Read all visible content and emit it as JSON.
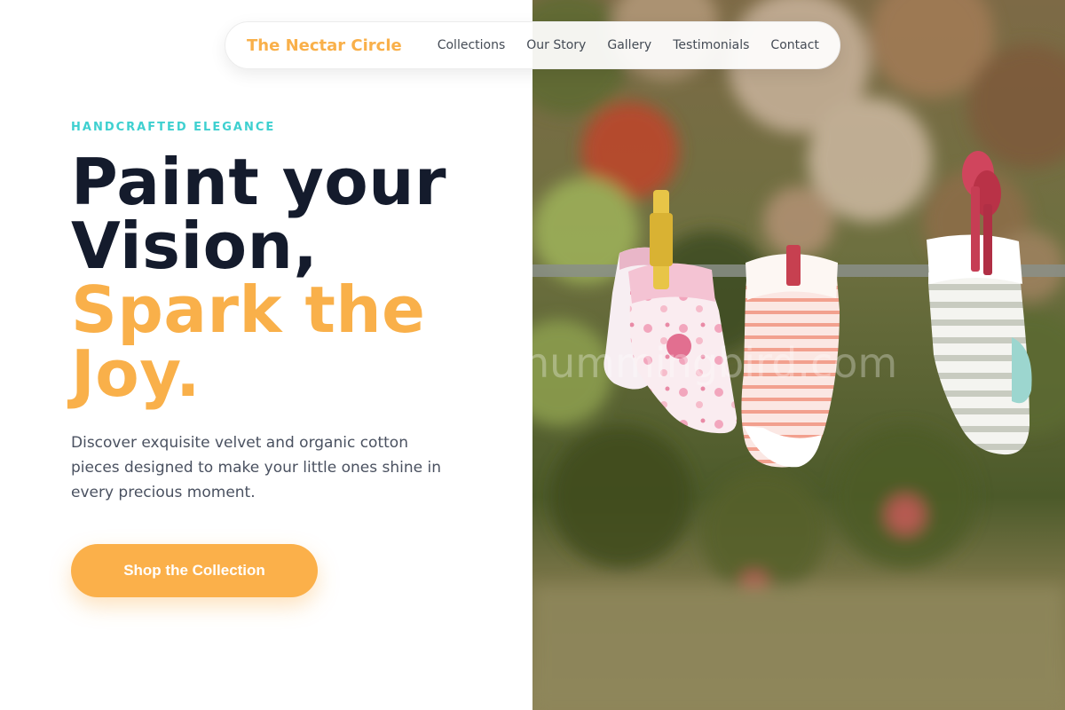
{
  "nav": {
    "brand": "The Nectar Circle",
    "links": [
      "Collections",
      "Our Story",
      "Gallery",
      "Testimonials",
      "Contact"
    ]
  },
  "hero": {
    "eyebrow": "HANDCRAFTED ELEGANCE",
    "headline_line1": "Paint your",
    "headline_line2": "Vision,",
    "headline_accent_line1": "Spark the",
    "headline_accent_line2": "Joy.",
    "lede": "Discover exquisite velvet and organic cotton pieces designed to make your little ones shine in every precious moment.",
    "cta_label": "Shop the Collection"
  },
  "image": {
    "watermark": "hummingbird.com",
    "alt_subject": "baby-socks-on-clothesline-photo"
  },
  "colors": {
    "accent": "#f9b04a",
    "eyebrow": "#3ed0d0",
    "heading": "#141b2c",
    "body_text": "#4a5160"
  }
}
